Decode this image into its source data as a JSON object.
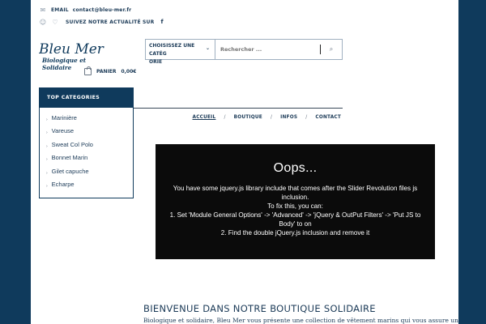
{
  "topbar": {
    "email_label": "EMAIL",
    "email_value": "contact@bleu-mer.fr",
    "follow_text": "SUIVEZ NOTRE ACTUALITÉ SUR",
    "social_icon": "f"
  },
  "logo": {
    "brand": "Bleu Mer",
    "tagline": "Biologique et Solidaire"
  },
  "cart": {
    "label": "PANIER",
    "amount": "0,00€"
  },
  "search": {
    "category_label": "CHOISISSEZ UNE CATÉGORIE",
    "category_line1": "CHOISISSEZ UNE CATÉG",
    "category_line2": "ORIE",
    "placeholder": "Rechercher ...",
    "button_icon": "search-icon"
  },
  "categories": {
    "title": "TOP CATEGORIES",
    "items": [
      "Marinière",
      "Vareuse",
      "Sweat Col Polo",
      "Bonnet Marin",
      "Gilet capuche",
      "Echarpe"
    ]
  },
  "nav": {
    "items": [
      "ACCUEIL",
      "BOUTIQUE",
      "INFOS",
      "CONTACT"
    ],
    "active": "ACCUEIL"
  },
  "slider_error": {
    "title": "Oops...",
    "line1": "You have some jquery.js library include that comes after the Slider Revolution files js inclusion.",
    "line2": "To fix this, you can:",
    "line3": "1. Set 'Module General Options' -> 'Advanced' -> 'jQuery & OutPut Filters' -> 'Put JS to Body' to on",
    "line4": "2. Find the double jQuery.js inclusion and remove it"
  },
  "welcome": {
    "title": "BIENVENUE DANS NOTRE BOUTIQUE SOLIDAIRE",
    "intro": "Biologique et solidaire, Bleu Mer vous présente une collection de vêtement marins qui vous assure un"
  },
  "colors": {
    "background": "#0f3a5c",
    "accent": "#0f3a5c",
    "text": "#1b3a57",
    "slider_bg": "#0b0b0b"
  }
}
